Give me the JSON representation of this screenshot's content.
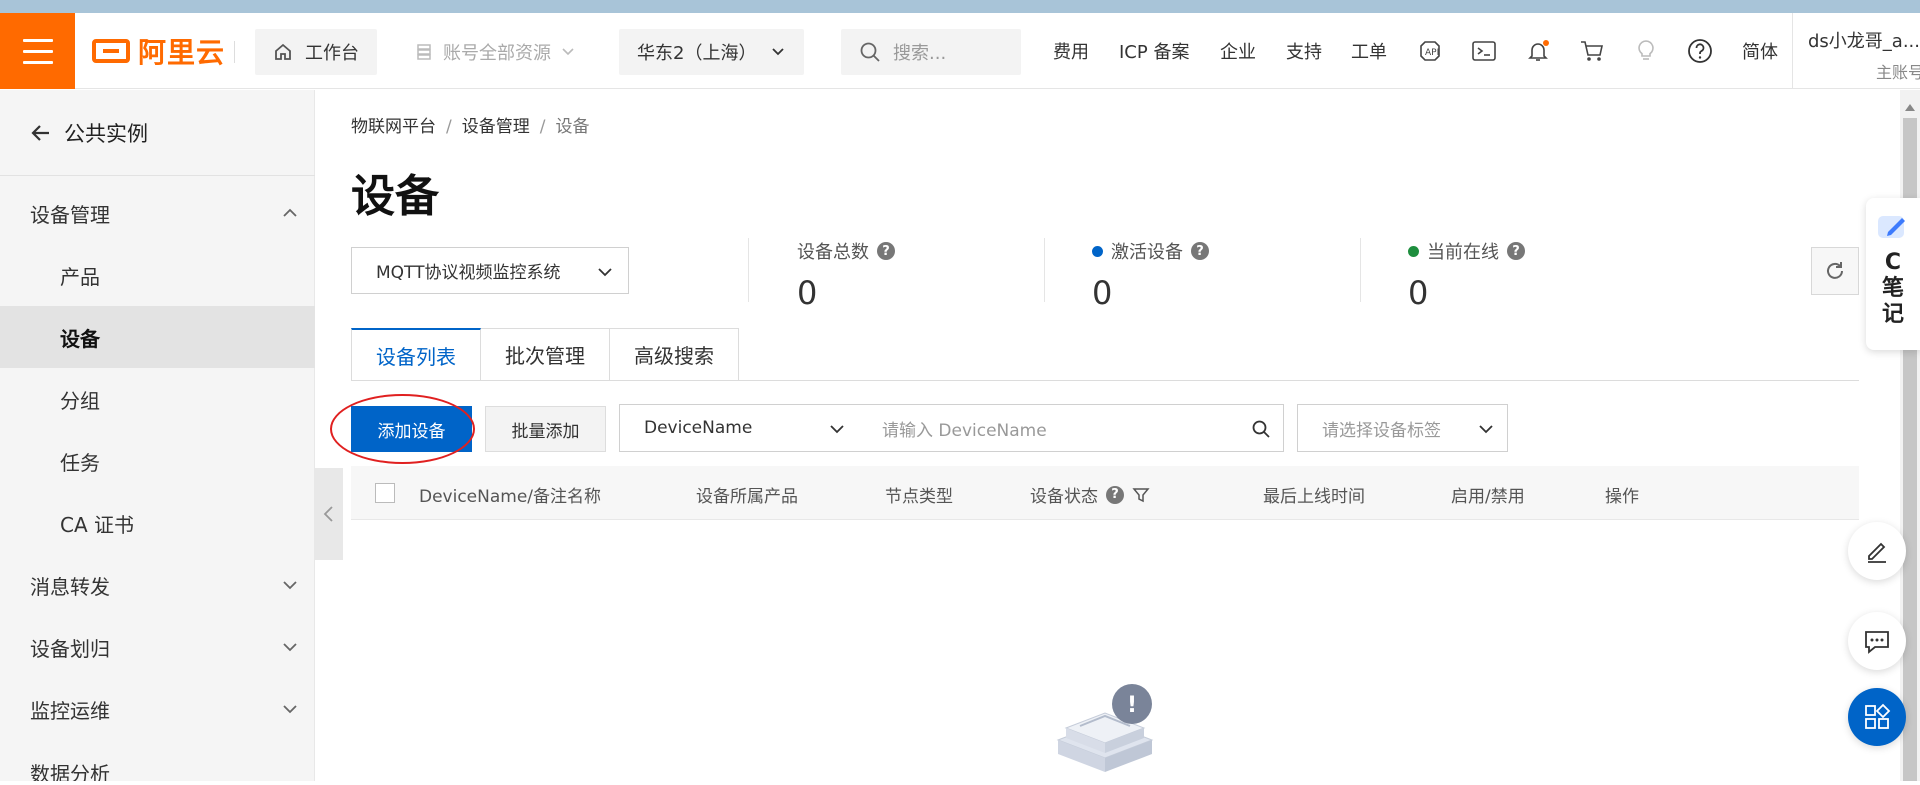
{
  "header": {
    "brand": "阿里云",
    "workbench": "工作台",
    "resources": "账号全部资源",
    "region": "华东2（上海）",
    "search_placeholder": "搜索...",
    "links": [
      "费用",
      "ICP 备案",
      "企业",
      "支持",
      "工单"
    ],
    "lang": "简体",
    "user_name": "ds小龙哥_a...",
    "user_role": "主账号",
    "accent_color": "#ff6a00"
  },
  "sidebar": {
    "back_label": "公共实例",
    "section_device_mgmt": "设备管理",
    "items": [
      "产品",
      "设备",
      "分组",
      "任务",
      "CA 证书"
    ],
    "active_item": "设备",
    "groups": [
      "消息转发",
      "设备划归",
      "监控运维",
      "数据分析"
    ]
  },
  "breadcrumb": [
    "物联网平台",
    "设备管理",
    "设备"
  ],
  "page": {
    "title": "设备",
    "product_select": "MQTT协议视频监控系统"
  },
  "stats": {
    "total_label": "设备总数",
    "total_value": "0",
    "active_label": "激活设备",
    "active_value": "0",
    "active_color": "#0064c8",
    "online_label": "当前在线",
    "online_value": "0",
    "online_color": "#1e8e3e"
  },
  "tabs": [
    "设备列表",
    "批次管理",
    "高级搜索"
  ],
  "toolbar": {
    "add_device": "添加设备",
    "batch_add": "批量添加",
    "search_type": "DeviceName",
    "search_placeholder": "请输入 DeviceName",
    "tag_placeholder": "请选择设备标签"
  },
  "table": {
    "columns": [
      "DeviceName/备注名称",
      "设备所属产品",
      "节点类型",
      "设备状态",
      "最后上线时间",
      "启用/禁用",
      "操作"
    ]
  },
  "notes_widget": {
    "line1": "C",
    "line2": "笔",
    "line3": "记"
  }
}
